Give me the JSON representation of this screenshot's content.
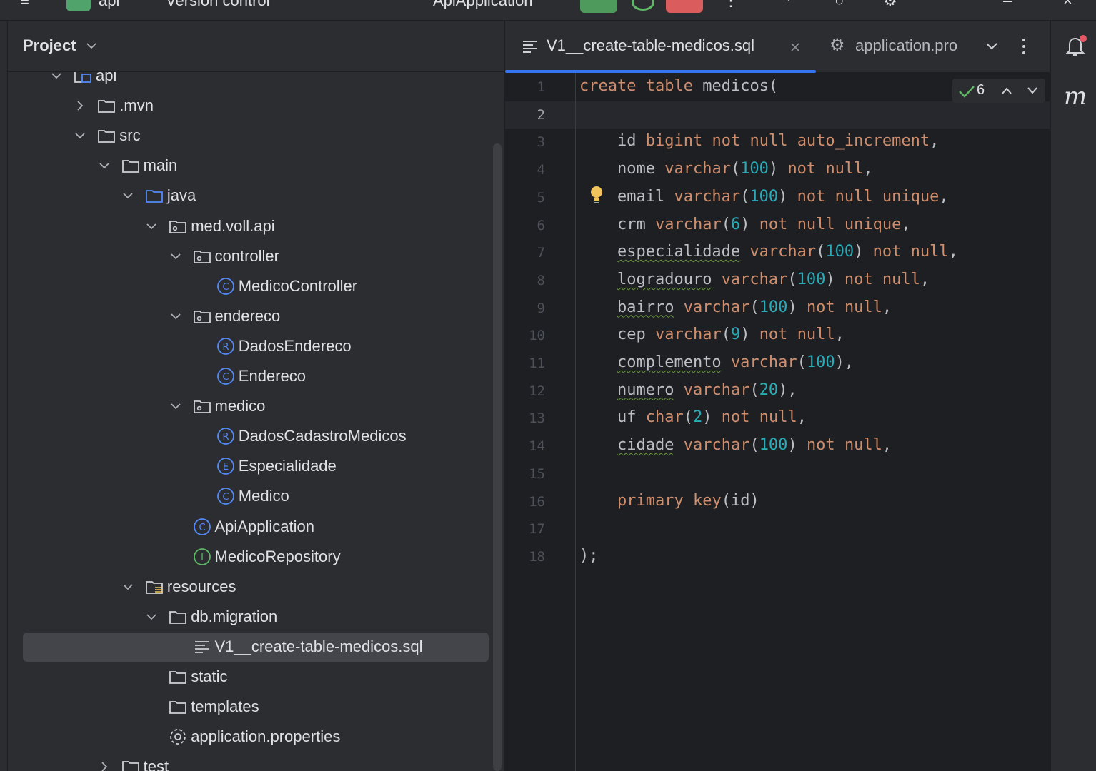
{
  "topbar": {
    "project_name": "api",
    "vcs_label": "Version control",
    "run_config": "ApiApplication"
  },
  "project_panel": {
    "title": "Project",
    "tree": [
      {
        "label": "api",
        "icon": "module-folder-icon",
        "depth": 2,
        "expanded": true
      },
      {
        "label": ".mvn",
        "icon": "folder-icon",
        "depth": 3,
        "expanded": false
      },
      {
        "label": "src",
        "icon": "folder-icon",
        "depth": 3,
        "expanded": true
      },
      {
        "label": "main",
        "icon": "folder-icon",
        "depth": 4,
        "expanded": true
      },
      {
        "label": "java",
        "icon": "source-folder-icon",
        "depth": 5,
        "expanded": true
      },
      {
        "label": "med.voll.api",
        "icon": "package-icon",
        "depth": 6,
        "expanded": true
      },
      {
        "label": "controller",
        "icon": "package-icon",
        "depth": 7,
        "expanded": true
      },
      {
        "label": "MedicoController",
        "icon": "class-icon",
        "depth": 8
      },
      {
        "label": "endereco",
        "icon": "package-icon",
        "depth": 7,
        "expanded": true
      },
      {
        "label": "DadosEndereco",
        "icon": "record-icon",
        "depth": 8
      },
      {
        "label": "Endereco",
        "icon": "class-icon",
        "depth": 8
      },
      {
        "label": "medico",
        "icon": "package-icon",
        "depth": 7,
        "expanded": true
      },
      {
        "label": "DadosCadastroMedicos",
        "icon": "record-icon",
        "depth": 8
      },
      {
        "label": "Especialidade",
        "icon": "enum-icon",
        "depth": 8
      },
      {
        "label": "Medico",
        "icon": "class-icon",
        "depth": 8
      },
      {
        "label": "ApiApplication",
        "icon": "class-icon",
        "depth": 7
      },
      {
        "label": "MedicoRepository",
        "icon": "interface-icon",
        "depth": 7
      },
      {
        "label": "resources",
        "icon": "resources-folder-icon",
        "depth": 5,
        "expanded": true
      },
      {
        "label": "db.migration",
        "icon": "folder-icon",
        "depth": 6,
        "expanded": true
      },
      {
        "label": "V1__create-table-medicos.sql",
        "icon": "sql-file-icon",
        "depth": 7,
        "selected": true
      },
      {
        "label": "static",
        "icon": "folder-icon",
        "depth": 6
      },
      {
        "label": "templates",
        "icon": "folder-icon",
        "depth": 6
      },
      {
        "label": "application.properties",
        "icon": "gear-icon",
        "depth": 6
      },
      {
        "label": "test",
        "icon": "folder-icon",
        "depth": 4,
        "expanded": false
      }
    ]
  },
  "editor": {
    "tabs": [
      {
        "label": "V1__create-table-medicos.sql",
        "icon": "sql-file-icon",
        "active": true,
        "closable": true
      },
      {
        "label": "application.pro",
        "icon": "gear-icon",
        "active": false
      }
    ],
    "inspection_count": "6",
    "current_line": 2,
    "line_numbers": [
      "1",
      "2",
      "3",
      "4",
      "5",
      "6",
      "7",
      "8",
      "9",
      "10",
      "11",
      "12",
      "13",
      "14",
      "15",
      "16",
      "17",
      "18"
    ],
    "code_lines": [
      "create table medicos(",
      "",
      "    id bigint not null auto_increment,",
      "    nome varchar(100) not null,",
      "    email varchar(100) not null unique,",
      "    crm varchar(6) not null unique,",
      "    especialidade varchar(100) not null,",
      "    logradouro varchar(100) not null,",
      "    bairro varchar(100) not null,",
      "    cep varchar(9) not null,",
      "    complemento varchar(100),",
      "    numero varchar(20),",
      "    uf char(2) not null,",
      "    cidade varchar(100) not null,",
      "",
      "    primary key(id)",
      "",
      ");"
    ]
  },
  "right_strip": {
    "plugin_label": "m"
  },
  "colors": {
    "panel_bg": "#2b2d30",
    "editor_bg": "#1e1f22",
    "selection": "#43454a",
    "accent": "#3574f0",
    "keyword": "#cf8e6d",
    "number": "#2aacb8"
  }
}
